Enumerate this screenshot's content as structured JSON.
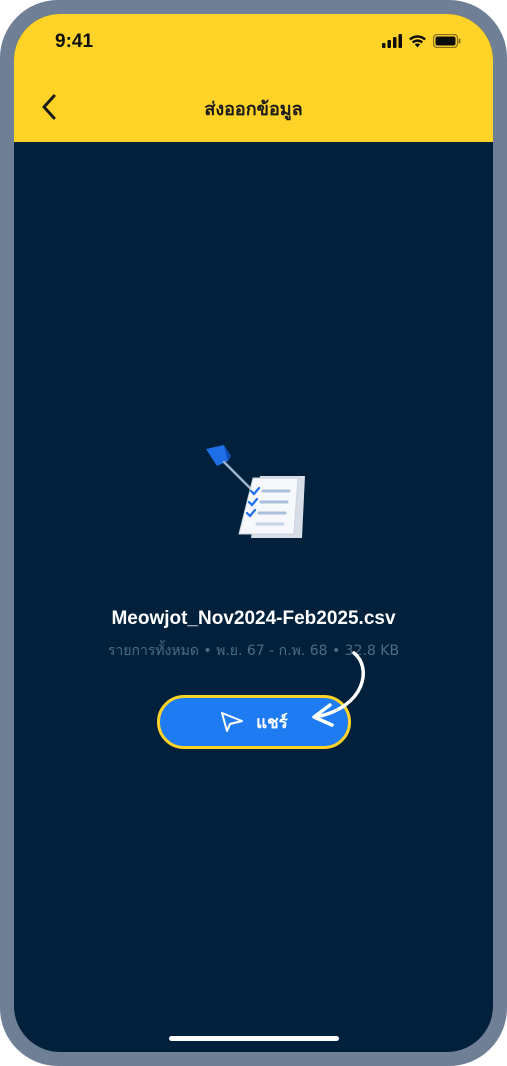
{
  "status_bar": {
    "time": "9:41"
  },
  "header": {
    "title": "ส่งออกข้อมูล",
    "background_color": "#ffd327"
  },
  "file": {
    "name": "Meowjot_Nov2024-Feb2025.csv",
    "meta": "รายการทั้งหมด • พ.ย. 67 - ก.พ. 68 • 32.8 KB",
    "icon": "document-checklist-icon"
  },
  "share": {
    "label": "แชร์",
    "icon": "send-icon",
    "color": "#1f7bf2"
  },
  "theme": {
    "screen_background": "#00203b",
    "accent": "#ffd327"
  }
}
